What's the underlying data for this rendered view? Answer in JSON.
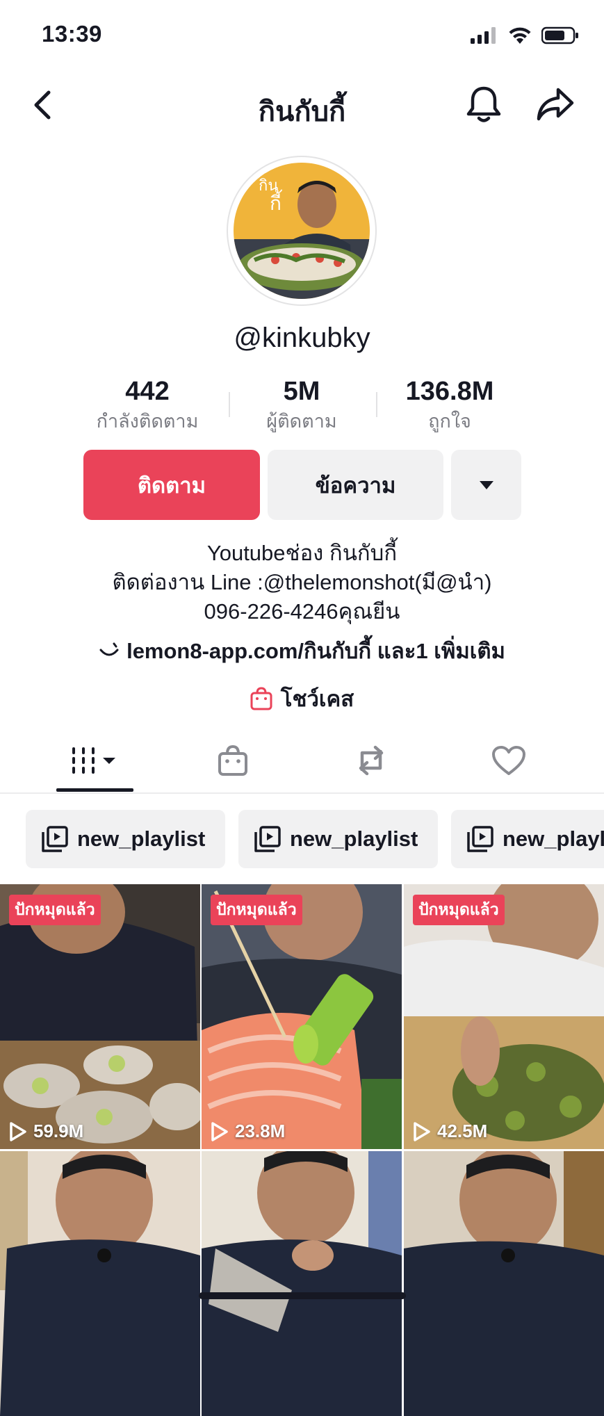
{
  "status_bar": {
    "time": "13:39"
  },
  "nav": {
    "title": "กินกับกี้"
  },
  "profile": {
    "username": "@kinkubky",
    "stats": [
      {
        "value": "442",
        "label": "กำลังติดตาม"
      },
      {
        "value": "5M",
        "label": "ผู้ติดตาม"
      },
      {
        "value": "136.8M",
        "label": "ถูกใจ"
      }
    ],
    "follow_label": "ติดตาม",
    "message_label": "ข้อความ",
    "bio_lines": [
      "Youtubeช่อง กินกับกี้",
      "ติดต่องาน Line :@thelemonshot(มี@นำ)",
      "096-226-4246คุณยีน"
    ],
    "link_text": "lemon8-app.com/กินกับกี้ และ1 เพิ่มเติม",
    "showcase_label": "โชว์เคส"
  },
  "tabs": [
    {
      "icon": "grid-videos-icon",
      "active": true
    },
    {
      "icon": "shopping-bag-icon",
      "active": false
    },
    {
      "icon": "repost-icon",
      "active": false
    },
    {
      "icon": "heart-icon",
      "active": false
    }
  ],
  "playlists": [
    {
      "label": "new_playlist"
    },
    {
      "label": "new_playlist"
    },
    {
      "label": "new_playlist"
    }
  ],
  "videos": [
    {
      "pinned_label": "ปักหมุดแล้ว",
      "views": "59.9M"
    },
    {
      "pinned_label": "ปักหมุดแล้ว",
      "views": "23.8M"
    },
    {
      "pinned_label": "ปักหมุดแล้ว",
      "views": "42.5M"
    },
    {
      "pinned_label": "",
      "views": ""
    },
    {
      "pinned_label": "",
      "views": ""
    },
    {
      "pinned_label": "",
      "views": ""
    }
  ],
  "colors": {
    "accent": "#ea4359",
    "secondary_btn": "#f1f1f2",
    "text": "#161823",
    "muted": "#7b7c83"
  }
}
